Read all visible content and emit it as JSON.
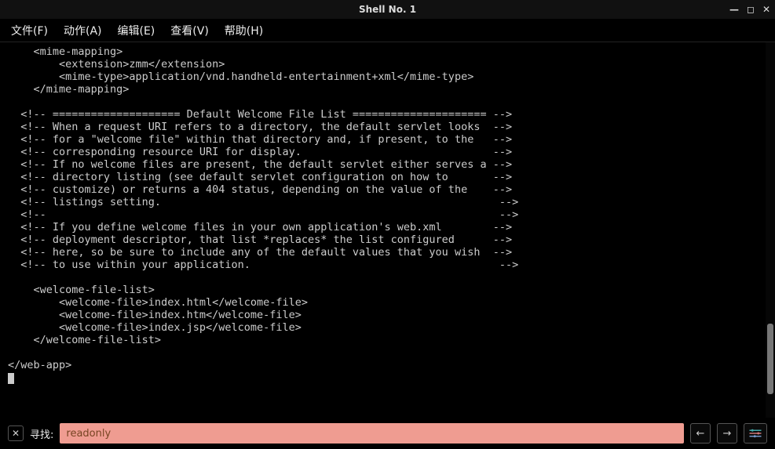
{
  "titlebar": {
    "title": "Shell No. 1"
  },
  "menubar": {
    "items": [
      {
        "label": "文件(F)"
      },
      {
        "label": "动作(A)"
      },
      {
        "label": "编辑(E)"
      },
      {
        "label": "查看(V)"
      },
      {
        "label": "帮助(H)"
      }
    ]
  },
  "terminal": {
    "content": "    <mime-mapping>\n        <extension>zmm</extension>\n        <mime-type>application/vnd.handheld-entertainment+xml</mime-type>\n    </mime-mapping>\n\n  <!-- ==================== Default Welcome File List ===================== -->\n  <!-- When a request URI refers to a directory, the default servlet looks  -->\n  <!-- for a \"welcome file\" within that directory and, if present, to the   -->\n  <!-- corresponding resource URI for display.                              -->\n  <!-- If no welcome files are present, the default servlet either serves a -->\n  <!-- directory listing (see default servlet configuration on how to       -->\n  <!-- customize) or returns a 404 status, depending on the value of the    -->\n  <!-- listings setting.                                                     -->\n  <!--                                                                       -->\n  <!-- If you define welcome files in your own application's web.xml        -->\n  <!-- deployment descriptor, that list *replaces* the list configured      -->\n  <!-- here, so be sure to include any of the default values that you wish  -->\n  <!-- to use within your application.                                       -->\n\n    <welcome-file-list>\n        <welcome-file>index.html</welcome-file>\n        <welcome-file>index.htm</welcome-file>\n        <welcome-file>index.jsp</welcome-file>\n    </welcome-file-list>\n\n</web-app>"
  },
  "search": {
    "label": "寻找:",
    "value": "readonly"
  }
}
